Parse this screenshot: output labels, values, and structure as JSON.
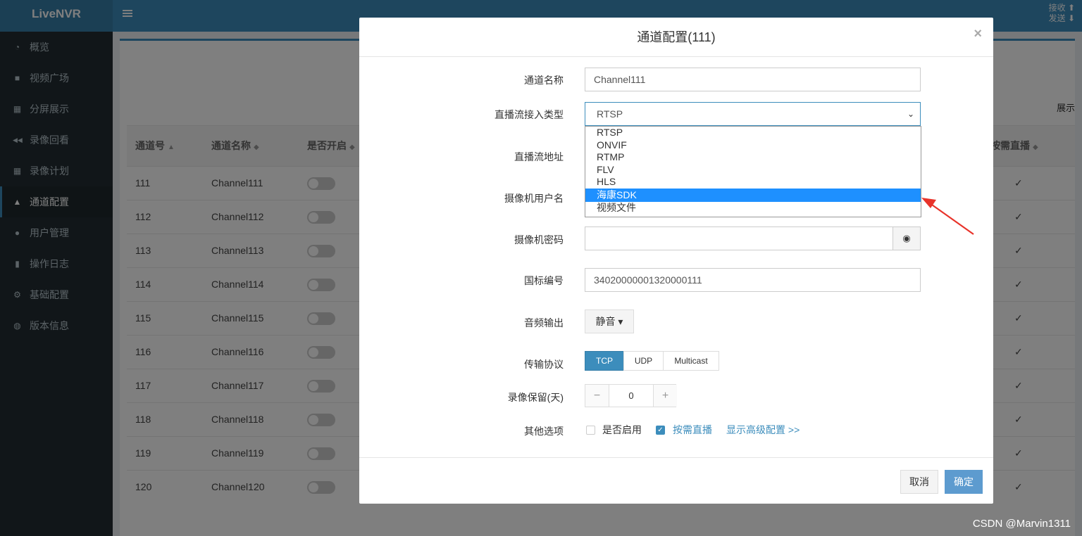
{
  "app": {
    "logo": "LiveNVR",
    "net_recv": "接收",
    "net_send": "发送"
  },
  "sidebar": {
    "items": [
      {
        "label": "概览",
        "icon": "dashboard-icon",
        "glyph": "◔"
      },
      {
        "label": "视频广场",
        "icon": "video-camera-icon",
        "glyph": "■"
      },
      {
        "label": "分屏展示",
        "icon": "grid-icon",
        "glyph": "▦"
      },
      {
        "label": "录像回看",
        "icon": "rewind-icon",
        "glyph": "◀◀"
      },
      {
        "label": "录像计划",
        "icon": "calendar-icon",
        "glyph": "▦"
      },
      {
        "label": "通道配置",
        "icon": "road-icon",
        "glyph": "▲",
        "active": true
      },
      {
        "label": "用户管理",
        "icon": "users-icon",
        "glyph": "●"
      },
      {
        "label": "操作日志",
        "icon": "file-icon",
        "glyph": "▮"
      },
      {
        "label": "基础配置",
        "icon": "cogs-icon",
        "glyph": "⚙"
      },
      {
        "label": "版本信息",
        "icon": "globe-icon",
        "glyph": "◍"
      }
    ]
  },
  "content": {
    "show_text": "展示",
    "table": {
      "headers": {
        "id": "通道号",
        "name": "通道名称",
        "enabled": "是否开启",
        "on_demand": "按需直播"
      },
      "rows": [
        {
          "id": "111",
          "name": "Channel111",
          "on_demand": "✓"
        },
        {
          "id": "112",
          "name": "Channel112",
          "on_demand": "✓"
        },
        {
          "id": "113",
          "name": "Channel113",
          "on_demand": "✓"
        },
        {
          "id": "114",
          "name": "Channel114",
          "on_demand": "✓"
        },
        {
          "id": "115",
          "name": "Channel115",
          "on_demand": "✓"
        },
        {
          "id": "116",
          "name": "Channel116",
          "on_demand": "✓"
        },
        {
          "id": "117",
          "name": "Channel117",
          "on_demand": "✓"
        },
        {
          "id": "118",
          "name": "Channel118",
          "on_demand": "✓"
        },
        {
          "id": "119",
          "name": "Channel119",
          "on_demand": "✓"
        },
        {
          "id": "120",
          "name": "Channel120",
          "on_demand": "✓"
        }
      ]
    }
  },
  "modal": {
    "title": "通道配置(111)",
    "close": "×",
    "fields": {
      "channel_name": {
        "label": "通道名称",
        "value": "Channel111"
      },
      "stream_type": {
        "label": "直播流接入类型",
        "value": "RTSP",
        "options": [
          "RTSP",
          "ONVIF",
          "RTMP",
          "FLV",
          "HLS",
          "海康SDK",
          "视频文件"
        ],
        "highlighted": "海康SDK"
      },
      "stream_url": {
        "label": "直播流地址"
      },
      "camera_user": {
        "label": "摄像机用户名"
      },
      "camera_password": {
        "label": "摄像机密码",
        "value": ""
      },
      "gb_id": {
        "label": "国标编号",
        "value": "34020000001320000111"
      },
      "audio": {
        "label": "音频输出",
        "value": "静音 ▾"
      },
      "transport": {
        "label": "传输协议",
        "options": [
          "TCP",
          "UDP",
          "Multicast"
        ],
        "selected": "TCP"
      },
      "retention": {
        "label": "录像保留(天)",
        "value": "0",
        "minus": "−",
        "plus": "+"
      },
      "other": {
        "label": "其他选项",
        "enabled_label": "是否启用",
        "enabled": false,
        "on_demand_label": "按需直播",
        "on_demand": true,
        "advanced_link": "显示高级配置 >>"
      }
    },
    "buttons": {
      "cancel": "取消",
      "ok": "确定"
    }
  },
  "watermark": "CSDN @Marvin1311",
  "colors": {
    "primary": "#3c8dbc",
    "sidebar": "#222d32",
    "highlight": "#1e90ff",
    "arrow": "#e8332a"
  }
}
